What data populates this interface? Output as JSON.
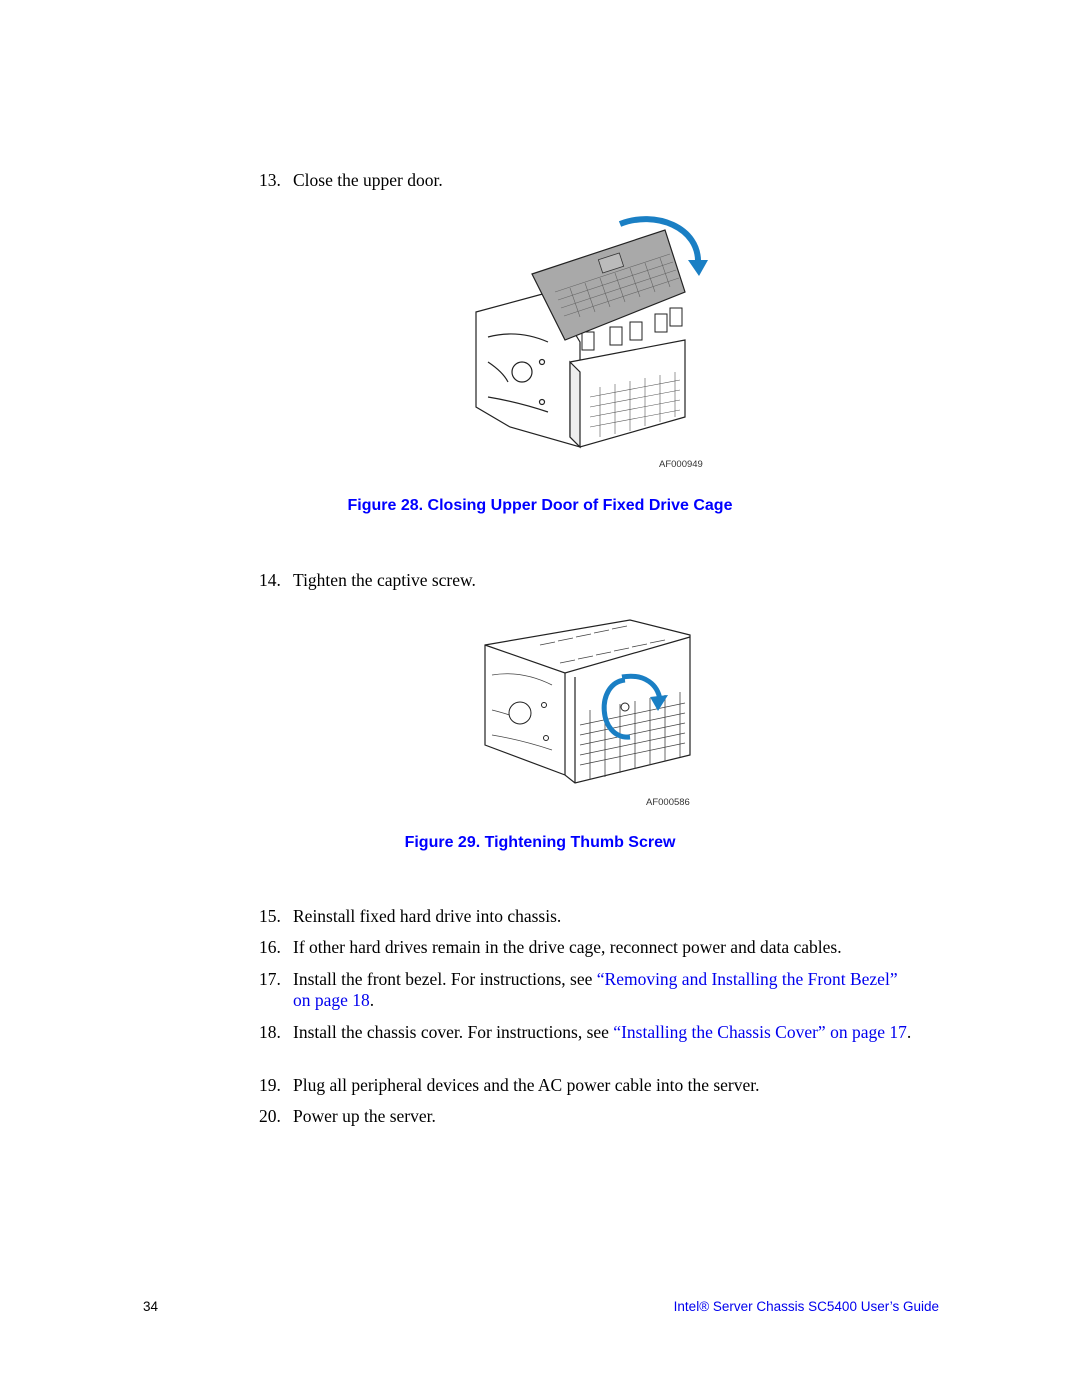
{
  "steps": [
    {
      "num": "13.",
      "text": "Close the upper door."
    },
    {
      "num": "14.",
      "text": "Tighten the captive screw."
    },
    {
      "num": "15.",
      "text": "Reinstall fixed hard drive into chassis."
    },
    {
      "num": "16.",
      "text": "If other hard drives remain in the drive cage, reconnect power and data cables."
    },
    {
      "num": "17.",
      "text_before": "Install the front bezel. For instructions, see ",
      "link": "“Removing and Installing the Front Bezel” on page 18",
      "text_after": "."
    },
    {
      "num": "18.",
      "text_before": "Install the chassis cover. For instructions, see ",
      "link": "“Installing the Chassis Cover” on page 17",
      "text_after": "."
    },
    {
      "num": "19.",
      "text": "Plug all peripheral devices and the AC power cable into the server."
    },
    {
      "num": "20.",
      "text": "Power up the server."
    }
  ],
  "figures": [
    {
      "id": "AF000949",
      "caption": "Figure 28. Closing Upper Door of Fixed Drive Cage",
      "illustration": "drive-cage-upper-door-closing"
    },
    {
      "id": "AF000586",
      "caption": "Figure 29. Tightening Thumb Screw",
      "illustration": "drive-cage-thumb-screw-tightening"
    }
  ],
  "footer": {
    "page_number": "34",
    "title": "Intel® Server Chassis SC5400 User’s Guide"
  },
  "colors": {
    "caption": "#0000ff",
    "link": "#0000ee",
    "arrow": "#1a7fc4"
  }
}
